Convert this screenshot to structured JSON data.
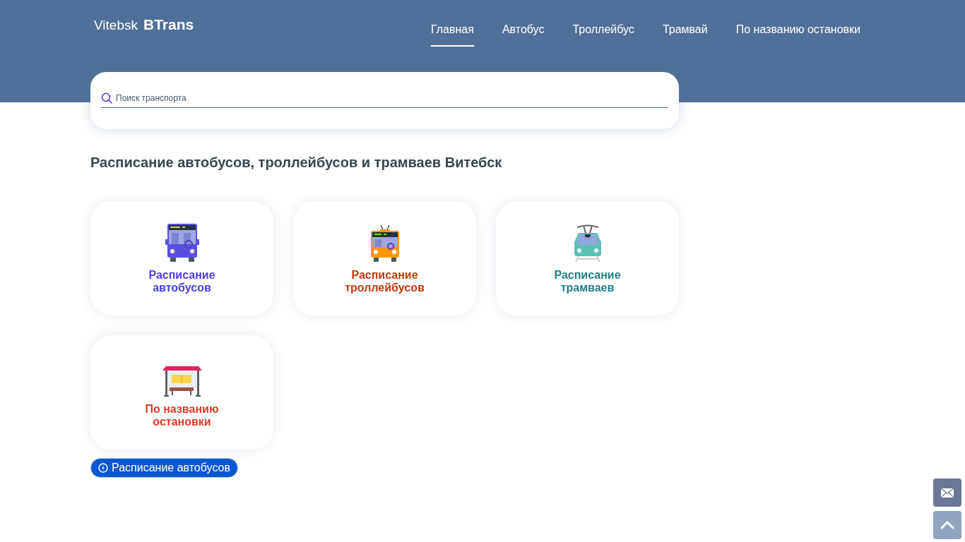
{
  "logo": {
    "city": "Vitebsk",
    "brand": "BTrans"
  },
  "nav": [
    {
      "label": "Главная",
      "selected": true
    },
    {
      "label": "Автобус",
      "selected": false
    },
    {
      "label": "Троллейбус",
      "selected": false
    },
    {
      "label": "Трамвай",
      "selected": false
    },
    {
      "label": "По названию остановки",
      "selected": false
    }
  ],
  "search": {
    "placeholder": "Поиск транспорта"
  },
  "heading": "Расписание автобусов, троллейбусов и трамваев Витебск",
  "cards": [
    {
      "kind": "bus",
      "title": "Расписание автобусов",
      "color": "#4b3fe0"
    },
    {
      "kind": "trolleybus",
      "title": "Расписание троллейбусов",
      "color": "#c53a0b"
    },
    {
      "kind": "tram",
      "title": "Расписание трамваев",
      "color": "#1f7f87"
    },
    {
      "kind": "stop",
      "title": "По названию остановки",
      "color": "#dc3b26"
    }
  ],
  "badge": {
    "label": "Расписание автобусов"
  }
}
